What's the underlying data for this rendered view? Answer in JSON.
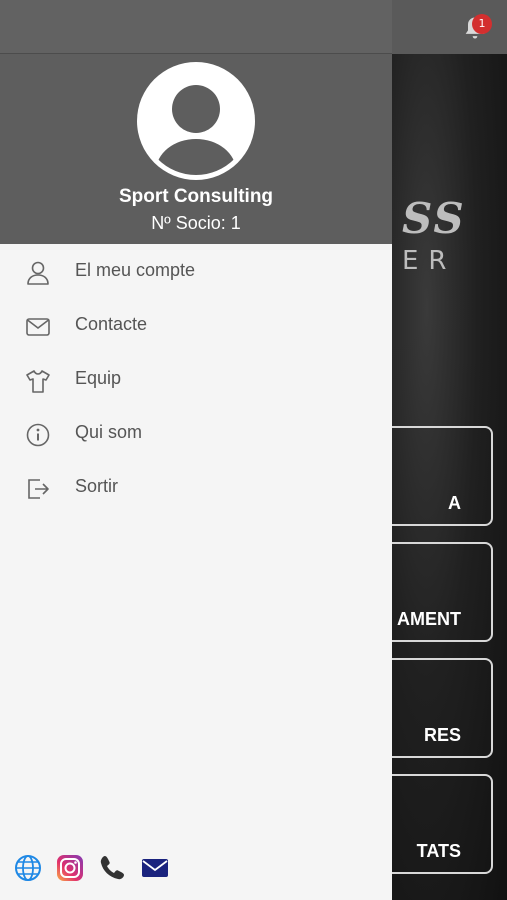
{
  "notifications": {
    "count": "1"
  },
  "background": {
    "logo_fragment": "SS",
    "logo_sub_fragment": "ER",
    "tiles": [
      {
        "label": "A"
      },
      {
        "label": "AMENT"
      },
      {
        "label": "RES"
      },
      {
        "label": "TATS"
      }
    ]
  },
  "drawer": {
    "user": {
      "name": "Sport Consulting",
      "socio": "Nº Socio: 1"
    },
    "menu": [
      {
        "label": "El meu compte",
        "icon": "user-icon"
      },
      {
        "label": "Contacte",
        "icon": "mail-icon"
      },
      {
        "label": "Equip",
        "icon": "shirt-icon"
      },
      {
        "label": "Qui som",
        "icon": "info-icon"
      },
      {
        "label": "Sortir",
        "icon": "logout-icon"
      }
    ],
    "footer_icons": [
      "globe-icon",
      "instagram-icon",
      "phone-icon",
      "email-icon"
    ]
  },
  "colors": {
    "header": "#5e5e5e",
    "drawer_bg": "#f5f5f5",
    "badge": "#d32f2f",
    "globe": "#1e88e5",
    "mail_footer": "#1a237e"
  }
}
